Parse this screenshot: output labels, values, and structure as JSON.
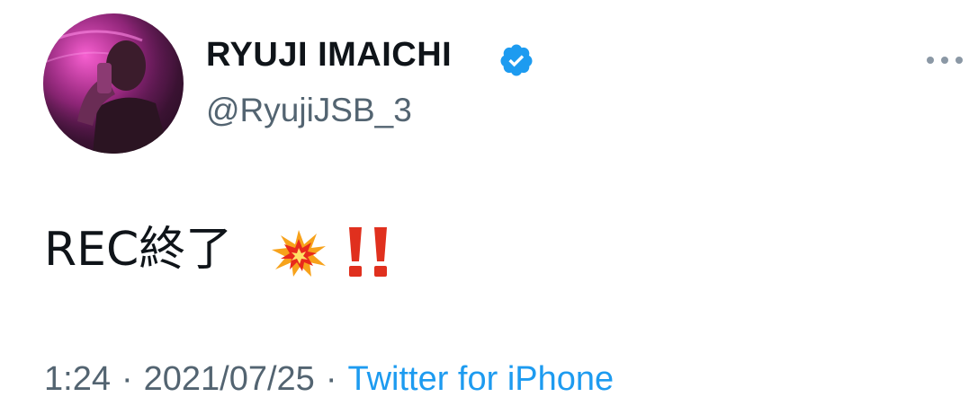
{
  "user": {
    "display_name": "RYUJI IMAICHI",
    "handle": "@RyujiJSB_3",
    "verified_icon": "verified-badge-icon"
  },
  "tweet": {
    "text": "REC終了",
    "emojis": [
      "collision-icon",
      "double-exclamation-icon"
    ]
  },
  "meta": {
    "time": "1:24",
    "separator": "·",
    "date": "2021/07/25",
    "source": "Twitter for iPhone"
  },
  "colors": {
    "primary_text": "#0f1419",
    "secondary_text": "#536471",
    "accent": "#1d9bf0"
  },
  "more_menu_icon": "more-options-icon"
}
